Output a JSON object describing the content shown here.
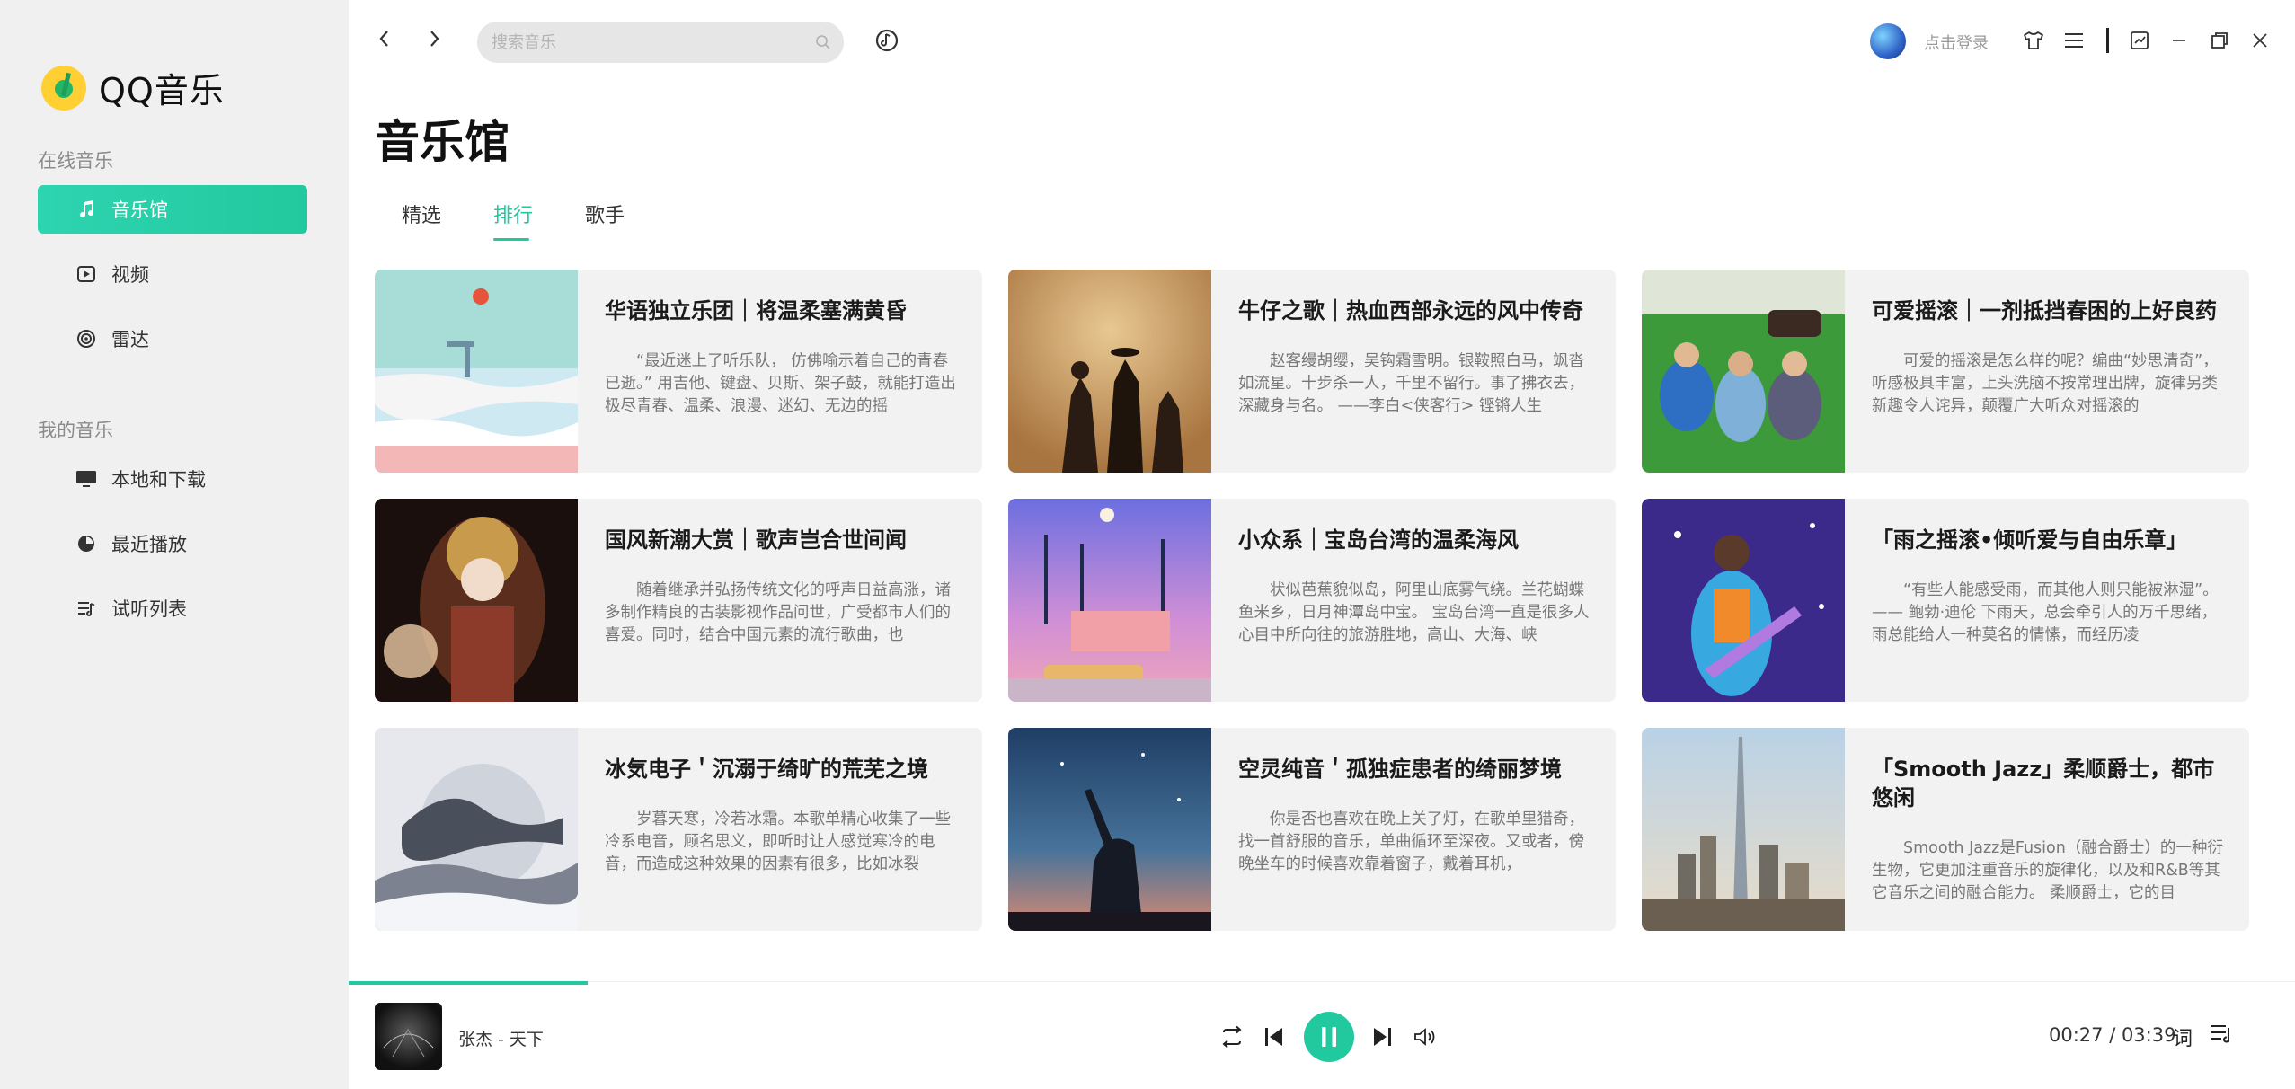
{
  "app": {
    "name": "QQ音乐"
  },
  "sidebar": {
    "online_section": "在线音乐",
    "online_items": [
      {
        "label": "音乐馆",
        "icon": "music-note-icon",
        "active": true
      },
      {
        "label": "视频",
        "icon": "video-icon",
        "active": false
      },
      {
        "label": "雷达",
        "icon": "radar-icon",
        "active": false
      }
    ],
    "mine_section": "我的音乐",
    "mine_items": [
      {
        "label": "本地和下载",
        "icon": "monitor-icon"
      },
      {
        "label": "最近播放",
        "icon": "clock-pie-icon"
      },
      {
        "label": "试听列表",
        "icon": "playlist-icon"
      }
    ]
  },
  "topbar": {
    "search_placeholder": "搜索音乐",
    "login_text": "点击登录"
  },
  "page": {
    "title": "音乐馆",
    "tabs": [
      {
        "label": "精选",
        "active": false
      },
      {
        "label": "排行",
        "active": true
      },
      {
        "label": "歌手",
        "active": false
      }
    ]
  },
  "cards": [
    {
      "title": "华语独立乐团｜将温柔塞满黄昏",
      "desc": "“最近迷上了听乐队， 仿佛喻示着自己的青春已逝。” 用吉他、键盘、贝斯、架子鼓，就能打造出极尽青春、温柔、浪漫、迷幻、无边的摇"
    },
    {
      "title": "牛仔之歌｜热血西部永远的风中传奇",
      "desc": "赵客缦胡缨，吴钩霜雪明。银鞍照白马，飒沓如流星。十步杀一人，千里不留行。事了拂衣去，深藏身与名。 ——李白<侠客行> 铿锵人生"
    },
    {
      "title": "可爱摇滚｜一剂抵挡春困的上好良药",
      "desc": "可爱的摇滚是怎么样的呢？编曲“妙思清奇”，听感极具丰富，上头洗脑不按常理出牌，旋律另类新趣令人诧异，颠覆广大听众对摇滚的"
    },
    {
      "title": "国风新潮大赏｜歌声岂合世间闻",
      "desc": "随着继承并弘扬传统文化的呼声日益高涨，诸多制作精良的古装影视作品问世，广受都市人们的喜爱。同时，结合中国元素的流行歌曲，也"
    },
    {
      "title": "小众系｜宝岛台湾的温柔海风",
      "desc": "状似芭蕉貌似岛，阿里山底雾气绕。兰花蝴蝶鱼米乡，日月神潭岛中宝。 宝岛台湾一直是很多人心目中所向往的旅游胜地，高山、大海、峡"
    },
    {
      "title": "「雨之摇滚•倾听爱与自由乐章」",
      "desc": "“有些人能感受雨，而其他人则只能被淋湿”。—— 鲍勃·迪伦 下雨天，总会牵引人的万千思绪，雨总能给人一种莫名的情愫，而经历凌"
    },
    {
      "title": "冰気电子＇沉溺于绮旷的荒芜之境",
      "desc": "岁暮天寒，冷若冰霜。本歌单精心收集了一些冷系电音，顾名思义，即听时让人感觉寒冷的电音，而造成这种效果的因素有很多，比如冰裂"
    },
    {
      "title": "空灵纯音＇孤独症患者的绮丽梦境",
      "desc": "你是否也喜欢在晚上关了灯，在歌单里猎奇，找一首舒服的音乐，单曲循环至深夜。又或者，傍晚坐车的时候喜欢靠着窗子，戴着耳机，"
    },
    {
      "title": "「Smooth Jazz」柔顺爵士，都市悠闲",
      "desc": "Smooth Jazz是Fusion（融合爵士）的一种衍生物，它更加注重音乐的旋律化，以及和R&B等其它音乐之间的融合能力。 柔顺爵士，它的目"
    }
  ],
  "player": {
    "now_playing": "张杰 - 天下",
    "time": "00:27 / 03:39",
    "lyric_label": "词",
    "progress": 0.123
  }
}
